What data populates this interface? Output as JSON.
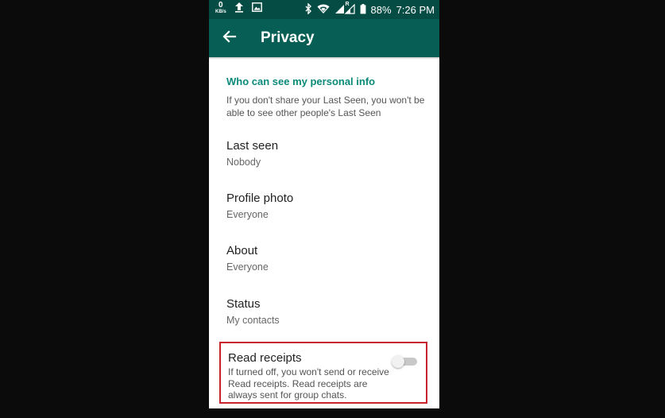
{
  "status_bar": {
    "speed_value": "0",
    "speed_unit": "KB/s",
    "battery": "88%",
    "time": "7:26 PM",
    "network_badge": "R"
  },
  "app_bar": {
    "title": "Privacy",
    "color": "#075e54"
  },
  "section": {
    "header": "Who can see my personal info",
    "description": "If you don't share your Last Seen, you won't be able to see other people's Last Seen"
  },
  "settings": [
    {
      "title": "Last seen",
      "value": "Nobody"
    },
    {
      "title": "Profile photo",
      "value": "Everyone"
    },
    {
      "title": "About",
      "value": "Everyone"
    },
    {
      "title": "Status",
      "value": "My contacts"
    }
  ],
  "read_receipts": {
    "title": "Read receipts",
    "description": "If turned off, you won't send or receive Read receipts. Read receipts are always sent for group chats.",
    "enabled": false,
    "highlight_color": "#c8232d"
  },
  "icons": [
    "upload-icon",
    "image-icon",
    "bluetooth-icon",
    "wifi-icon",
    "signal-icon",
    "battery-icon",
    "back-arrow-icon"
  ]
}
